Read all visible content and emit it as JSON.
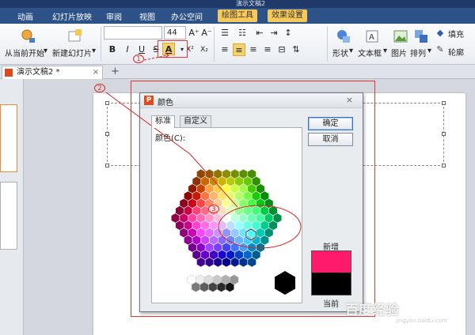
{
  "window": {
    "title": "演示文稿2"
  },
  "menu": {
    "items": [
      "动画",
      "幻灯片放映",
      "审阅",
      "视图",
      "办公空间",
      "绘图工具",
      "效果设置"
    ]
  },
  "ribbon": {
    "start_from_current": "从当前开始",
    "new_slide": "新建幻灯片",
    "font_size": "44",
    "grow_font": "A⁺",
    "shrink_font": "A⁻",
    "bold": "B",
    "italic": "I",
    "underline": "U",
    "strike": "S",
    "font_color": "A",
    "superscript": "X²",
    "subscript": "X₂",
    "shape": "形状",
    "textbox": "文本框",
    "picture": "图片",
    "arrange": "排列",
    "fill": "填充",
    "outline": "轮廓"
  },
  "doc_tab": {
    "label": "演示文稿2 *",
    "add": "+"
  },
  "dialog": {
    "title": "颜色",
    "close": "×",
    "tabs": [
      "标准",
      "自定义"
    ],
    "color_label": "颜色(C):",
    "ok": "确定",
    "cancel": "取消",
    "new_label": "新增",
    "current_label": "当前",
    "new_color": "#ff1a6b",
    "current_color": "#000000"
  },
  "annotations": [
    "1",
    "2",
    "3"
  ],
  "watermark": {
    "text": "百度经验",
    "sub": "jingyan.baidu.com"
  }
}
